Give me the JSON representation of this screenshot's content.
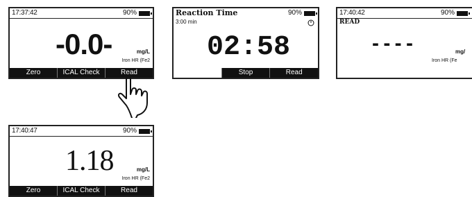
{
  "screens": [
    {
      "time": "17:37:42",
      "battery": "90%",
      "reading": "-0.0-",
      "unit": "mg/L",
      "method": "Iron HR (Fe2",
      "softkeys": [
        "Zero",
        "ICAL Check",
        "Read"
      ]
    },
    {
      "title": "Reaction Time",
      "battery": "90%",
      "sub": "3:00 min",
      "reading": "02:58",
      "softkeys": [
        "",
        "Stop",
        "Read"
      ]
    },
    {
      "time": "17:40:42",
      "battery": "90%",
      "header": "READ",
      "reading": "- - - -",
      "unit": "mg/",
      "method": "Iron HR (Fe"
    },
    {
      "time": "17:40:47",
      "battery": "90%",
      "reading": "1.18",
      "unit": "mg/L",
      "method": "Iron HR (Fe2",
      "softkeys": [
        "Zero",
        "ICAL Check",
        "Read"
      ]
    }
  ]
}
